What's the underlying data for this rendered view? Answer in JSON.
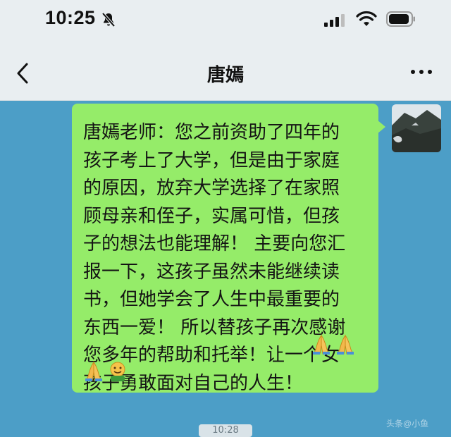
{
  "status_bar": {
    "time": "10:25",
    "icons": [
      "mute-icon",
      "signal-icon",
      "wifi-icon",
      "battery-icon"
    ]
  },
  "nav": {
    "back_icon": "chevron-left-icon",
    "title": "唐嫣",
    "more_icon": "more-dots-icon"
  },
  "message": {
    "sender": "self",
    "lines": [
      "唐嫣老师：您之前资助了四年的",
      "孩子考上了大学，但是由于家庭",
      "的原因，放弃大学选择了在家照",
      "顾母亲和侄子，实属可惜，但孩",
      "子的想法也能理解！ 主要向您汇",
      "报一下，这孩子虽然未能继续读",
      "书，但她学会了人生中最重要的",
      "东西一爱！ 所以替孩子再次感谢",
      "您多年的帮助和托举！让一个女",
      "孩子勇敢面对自己的人生！"
    ],
    "trailing_emojis": [
      "praying-hands-emoji",
      "praying-hands-emoji",
      "praying-hands-emoji",
      "hugging-face-emoji"
    ],
    "bubble_color": "#95ec69"
  },
  "timestamp": "10:28",
  "watermark": "头条@小鱼",
  "colors": {
    "chat_background": "#4c9ec7",
    "header_background": "#e9eef1"
  }
}
